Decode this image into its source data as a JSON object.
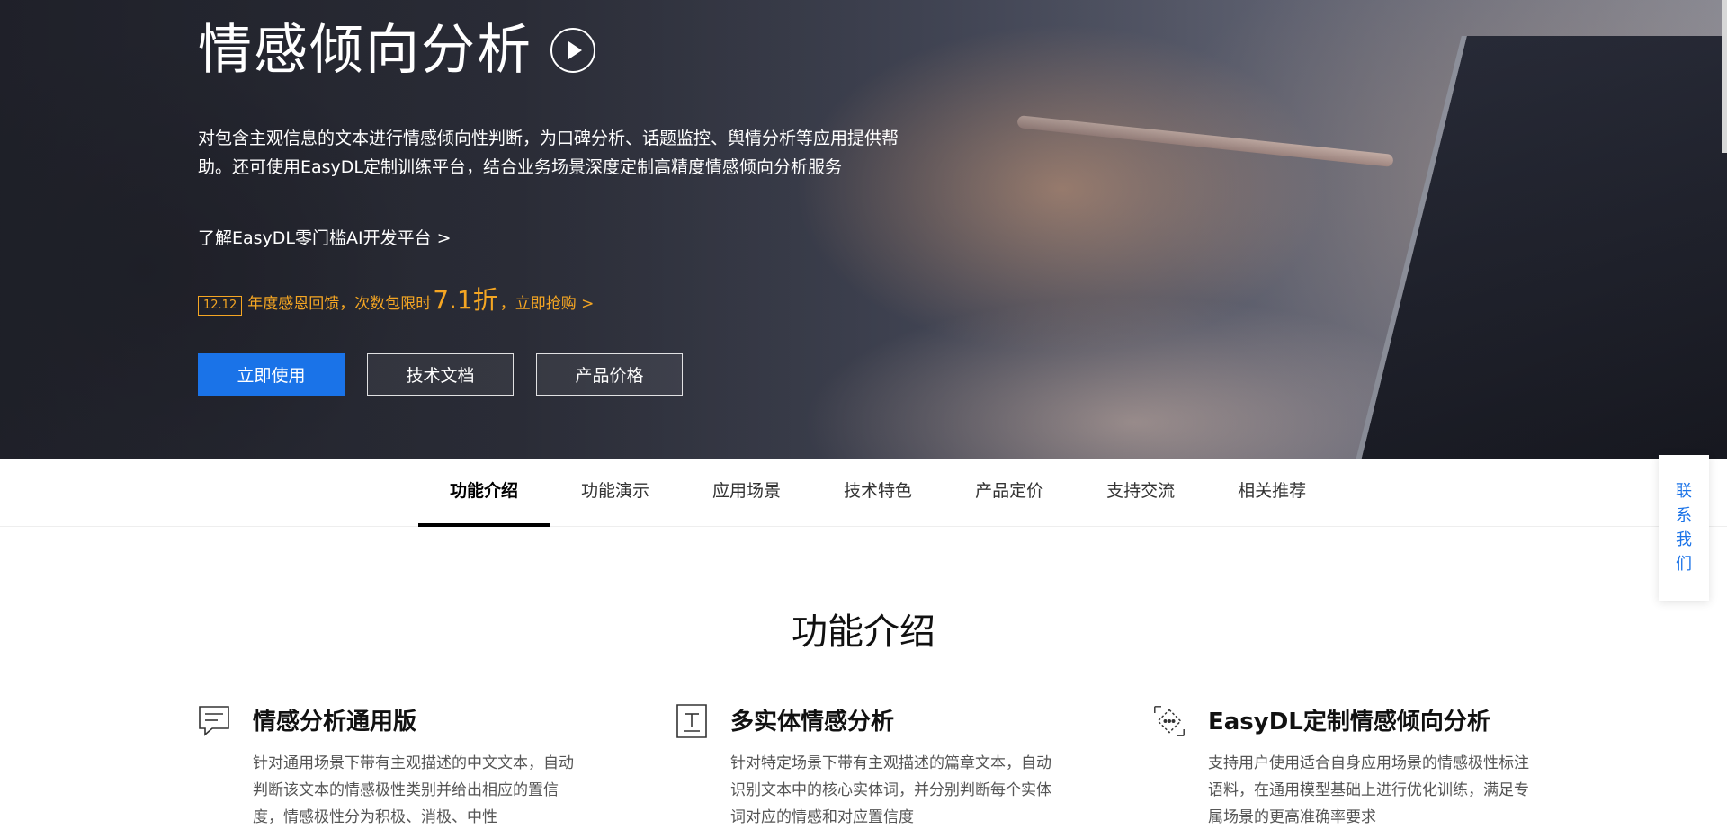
{
  "hero": {
    "title": "情感倾向分析",
    "description": "对包含主观信息的文本进行情感倾向性判断，为口碑分析、话题监控、舆情分析等应用提供帮助。还可使用EasyDL定制训练平台，结合业务场景深度定制高精度情感倾向分析服务",
    "easydl_link": "了解EasyDL零门槛AI开发平台 >",
    "promo": {
      "date_badge": "12.12",
      "text_before": "年度感恩回馈，次数包限时",
      "discount": "7.1折",
      "cta": "，立即抢购 >"
    },
    "buttons": {
      "use_now": "立即使用",
      "docs": "技术文档",
      "pricing": "产品价格"
    }
  },
  "tabs": [
    {
      "label": "功能介绍",
      "active": true
    },
    {
      "label": "功能演示"
    },
    {
      "label": "应用场景"
    },
    {
      "label": "技术特色"
    },
    {
      "label": "产品定价"
    },
    {
      "label": "支持交流"
    },
    {
      "label": "相关推荐"
    }
  ],
  "contact": [
    "联",
    "系",
    "我",
    "们"
  ],
  "section": {
    "title": "功能介绍",
    "features": [
      {
        "icon": "chat-bubble-icon",
        "title": "情感分析通用版",
        "text": "针对通用场景下带有主观描述的中文文本，自动判断该文本的情感极性类别并给出相应的置信度，情感极性分为积极、消极、中性"
      },
      {
        "icon": "text-document-icon",
        "title": "多实体情感分析",
        "text": "针对特定场景下带有主观描述的篇章文本，自动识别文本中的核心实体词，并分别判断每个实体词对应的情感和对应置信度"
      },
      {
        "icon": "custom-tag-icon",
        "title": "EasyDL定制情感倾向分析",
        "text": "支持用户使用适合自身应用场景的情感极性标注语料，在通用模型基础上进行优化训练，满足专属场景的更高准确率要求"
      }
    ]
  },
  "colors": {
    "primary": "#1a73e8",
    "promo": "#f5a623"
  }
}
